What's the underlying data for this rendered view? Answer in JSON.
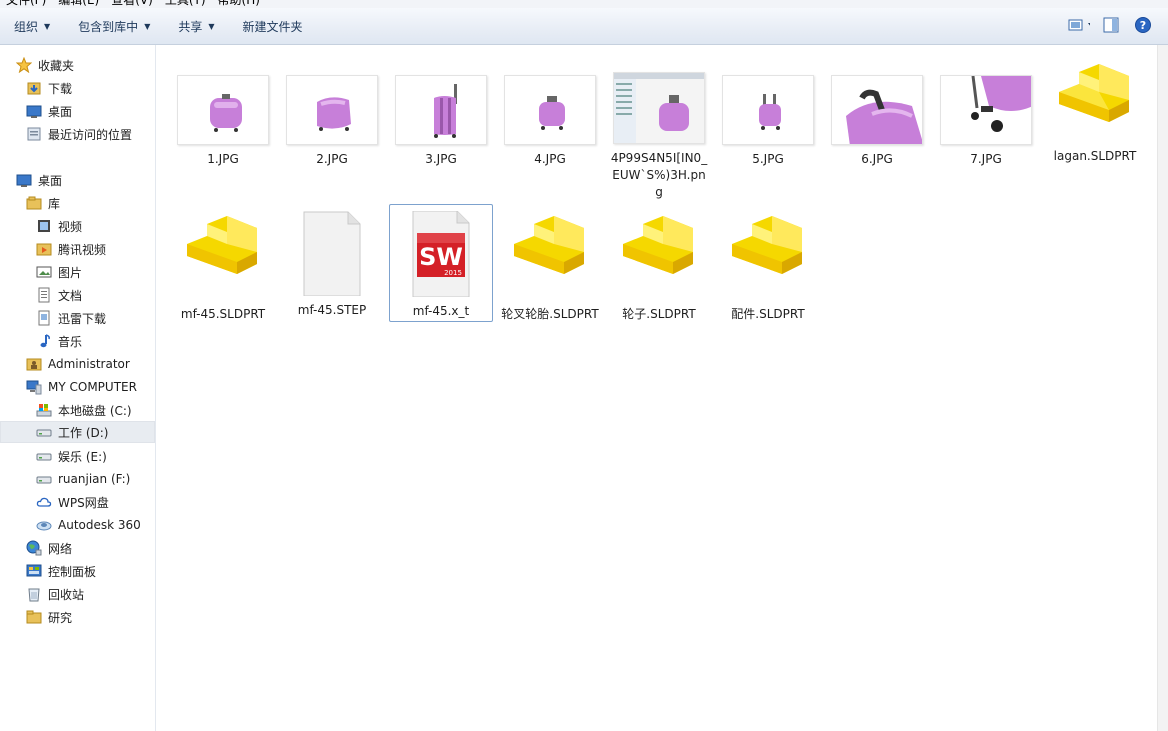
{
  "menu": [
    "文件(F)",
    "编辑(E)",
    "查看(V)",
    "工具(T)",
    "帮助(H)"
  ],
  "toolbar": {
    "organize": "组织",
    "include_library": "包含到库中",
    "share": "共享",
    "new_folder": "新建文件夹",
    "help": "?"
  },
  "nav": {
    "favorites": "收藏夹",
    "downloads": "下载",
    "desktop_fav": "桌面",
    "recent": "最近访问的位置",
    "desktop": "桌面",
    "libraries": "库",
    "videos": "视频",
    "tencent_video": "腾讯视频",
    "pictures": "图片",
    "documents": "文档",
    "thunder": "迅雷下载",
    "music": "音乐",
    "administrator": "Administrator",
    "computer": "MY COMPUTER",
    "drive_c": "本地磁盘 (C:)",
    "drive_d": "工作 (D:)",
    "drive_e": "娱乐 (E:)",
    "drive_f": "ruanjian (F:)",
    "wps": "WPS网盘",
    "autodesk": "Autodesk 360",
    "network": "网络",
    "control_panel": "控制面板",
    "recycle": "回收站",
    "research": "研究"
  },
  "files": [
    {
      "name": "1.JPG"
    },
    {
      "name": "2.JPG"
    },
    {
      "name": "3.JPG"
    },
    {
      "name": "4.JPG"
    },
    {
      "name": "4P99S4N5I[IN0_EUW`S%)3H.png"
    },
    {
      "name": "5.JPG"
    },
    {
      "name": "6.JPG"
    },
    {
      "name": "7.JPG"
    },
    {
      "name": "lagan.SLDPRT"
    },
    {
      "name": "mf-45.SLDPRT"
    },
    {
      "name": "mf-45.STEP"
    },
    {
      "name": "mf-45.x_t"
    },
    {
      "name": "轮叉轮胎.SLDPRT"
    },
    {
      "name": "轮子.SLDPRT"
    },
    {
      "name": "配件.SLDPRT"
    }
  ],
  "sw_badge": {
    "letters": "SW",
    "year": "2015"
  },
  "colors": {
    "accent": "#2a66c2",
    "suitcase": "#c77fd9",
    "part_yellow": "#f5d800",
    "sw_red": "#d42027"
  }
}
